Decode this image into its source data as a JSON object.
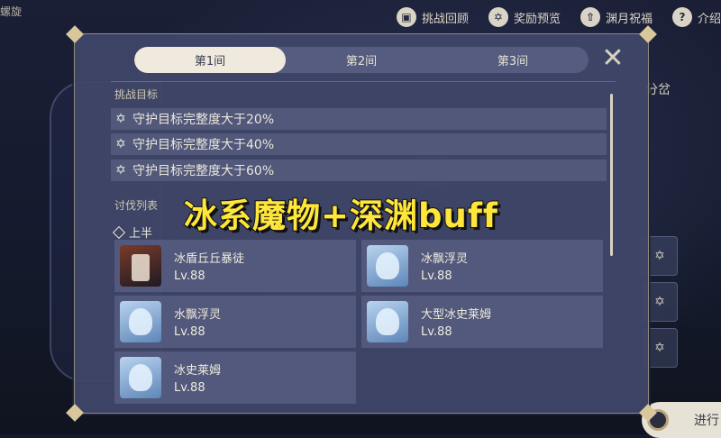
{
  "top_left_text": "螺旋",
  "top_bar": [
    {
      "icon": "book-icon",
      "glyph": "▣",
      "label": "挑战回顾"
    },
    {
      "icon": "star-icon",
      "glyph": "✡",
      "label": "奖励预览"
    },
    {
      "icon": "up-arrow-icon",
      "glyph": "⇧",
      "label": "渊月祝福"
    },
    {
      "icon": "help-icon",
      "glyph": "?",
      "label": "介绍"
    }
  ],
  "right_side_label": "分岔",
  "start_button_label": "进行",
  "tabs": [
    {
      "label": "第1间",
      "active": true
    },
    {
      "label": "第2间",
      "active": false
    },
    {
      "label": "第3间",
      "active": false
    }
  ],
  "challenge": {
    "title": "挑战目标",
    "goals": [
      "守护目标完整度大于20%",
      "守护目标完整度大于40%",
      "守护目标完整度大于60%"
    ]
  },
  "enemies": {
    "title": "讨伐列表",
    "half_label": "上半",
    "list": [
      {
        "name": "冰盾丘丘暴徒",
        "level": "Lv.88",
        "portrait": "ice-shield-hilichurl-brute-icon"
      },
      {
        "name": "冰飘浮灵",
        "level": "Lv.88",
        "portrait": "cryo-specter-icon"
      },
      {
        "name": "水飘浮灵",
        "level": "Lv.88",
        "portrait": "hydro-specter-icon"
      },
      {
        "name": "大型冰史莱姆",
        "level": "Lv.88",
        "portrait": "large-cryo-slime-icon"
      },
      {
        "name": "冰史莱姆",
        "level": "Lv.88",
        "portrait": "cryo-slime-icon"
      }
    ]
  },
  "overlay_caption": "冰系魔物+深渊buff",
  "colors": {
    "caption": "#ffe63a",
    "panel": "#404668",
    "tab_active": "#efeadd"
  }
}
